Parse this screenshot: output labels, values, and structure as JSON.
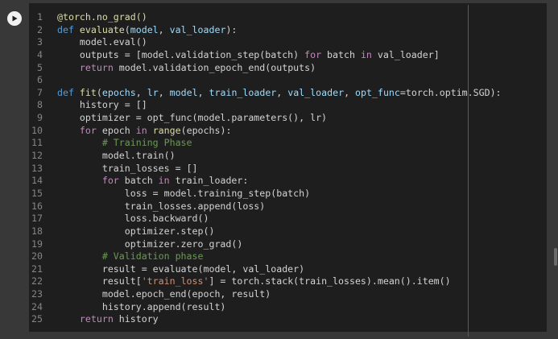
{
  "run_button": {
    "icon": "play-icon"
  },
  "code": {
    "lines": [
      {
        "n": "1",
        "tokens": [
          {
            "t": "@torch.no_grad()",
            "c": "fn"
          }
        ]
      },
      {
        "n": "2",
        "tokens": [
          {
            "t": "def ",
            "c": "kw"
          },
          {
            "t": "evaluate",
            "c": "fn"
          },
          {
            "t": "(",
            "c": "plain"
          },
          {
            "t": "model",
            "c": "param"
          },
          {
            "t": ", ",
            "c": "plain"
          },
          {
            "t": "val_loader",
            "c": "param"
          },
          {
            "t": "):",
            "c": "plain"
          }
        ]
      },
      {
        "n": "3",
        "tokens": [
          {
            "t": "    model.eval()",
            "c": "plain"
          }
        ]
      },
      {
        "n": "4",
        "tokens": [
          {
            "t": "    outputs = [model.validation_step(batch) ",
            "c": "plain"
          },
          {
            "t": "for",
            "c": "kw2"
          },
          {
            "t": " batch ",
            "c": "plain"
          },
          {
            "t": "in",
            "c": "kw2"
          },
          {
            "t": " val_loader]",
            "c": "plain"
          }
        ]
      },
      {
        "n": "5",
        "tokens": [
          {
            "t": "    ",
            "c": "plain"
          },
          {
            "t": "return",
            "c": "kw2"
          },
          {
            "t": " model.validation_epoch_end(outputs)",
            "c": "plain"
          }
        ]
      },
      {
        "n": "6",
        "tokens": []
      },
      {
        "n": "7",
        "tokens": [
          {
            "t": "def ",
            "c": "kw"
          },
          {
            "t": "fit",
            "c": "fn"
          },
          {
            "t": "(",
            "c": "plain"
          },
          {
            "t": "epochs",
            "c": "param"
          },
          {
            "t": ", ",
            "c": "plain"
          },
          {
            "t": "lr",
            "c": "param"
          },
          {
            "t": ", ",
            "c": "plain"
          },
          {
            "t": "model",
            "c": "param"
          },
          {
            "t": ", ",
            "c": "plain"
          },
          {
            "t": "train_loader",
            "c": "param"
          },
          {
            "t": ", ",
            "c": "plain"
          },
          {
            "t": "val_loader",
            "c": "param"
          },
          {
            "t": ", ",
            "c": "plain"
          },
          {
            "t": "opt_func",
            "c": "param"
          },
          {
            "t": "=torch.optim.SGD):",
            "c": "plain"
          }
        ]
      },
      {
        "n": "8",
        "tokens": [
          {
            "t": "    history = []",
            "c": "plain"
          }
        ]
      },
      {
        "n": "9",
        "tokens": [
          {
            "t": "    optimizer = opt_func(model.parameters(), lr)",
            "c": "plain"
          }
        ]
      },
      {
        "n": "10",
        "tokens": [
          {
            "t": "    ",
            "c": "plain"
          },
          {
            "t": "for",
            "c": "kw2"
          },
          {
            "t": " epoch ",
            "c": "plain"
          },
          {
            "t": "in",
            "c": "kw2"
          },
          {
            "t": " ",
            "c": "plain"
          },
          {
            "t": "range",
            "c": "fn"
          },
          {
            "t": "(epochs):",
            "c": "plain"
          }
        ]
      },
      {
        "n": "11",
        "tokens": [
          {
            "t": "        # Training Phase",
            "c": "cm"
          }
        ]
      },
      {
        "n": "12",
        "tokens": [
          {
            "t": "        model.train()",
            "c": "plain"
          }
        ]
      },
      {
        "n": "13",
        "tokens": [
          {
            "t": "        train_losses = []",
            "c": "plain"
          }
        ]
      },
      {
        "n": "14",
        "tokens": [
          {
            "t": "        ",
            "c": "plain"
          },
          {
            "t": "for",
            "c": "kw2"
          },
          {
            "t": " batch ",
            "c": "plain"
          },
          {
            "t": "in",
            "c": "kw2"
          },
          {
            "t": " train_loader:",
            "c": "plain"
          }
        ]
      },
      {
        "n": "15",
        "tokens": [
          {
            "t": "            loss = model.training_step(batch)",
            "c": "plain"
          }
        ]
      },
      {
        "n": "16",
        "tokens": [
          {
            "t": "            train_losses.append(loss)",
            "c": "plain"
          }
        ]
      },
      {
        "n": "17",
        "tokens": [
          {
            "t": "            loss.backward()",
            "c": "plain"
          }
        ]
      },
      {
        "n": "18",
        "tokens": [
          {
            "t": "            optimizer.step()",
            "c": "plain"
          }
        ]
      },
      {
        "n": "19",
        "tokens": [
          {
            "t": "            optimizer.zero_grad()",
            "c": "plain"
          }
        ]
      },
      {
        "n": "20",
        "tokens": [
          {
            "t": "        # Validation phase",
            "c": "cm"
          }
        ]
      },
      {
        "n": "21",
        "tokens": [
          {
            "t": "        result = evaluate(model, val_loader)",
            "c": "plain"
          }
        ]
      },
      {
        "n": "22",
        "tokens": [
          {
            "t": "        result[",
            "c": "plain"
          },
          {
            "t": "'train_loss'",
            "c": "str"
          },
          {
            "t": "] = torch.stack(train_losses).mean().item()",
            "c": "plain"
          }
        ]
      },
      {
        "n": "23",
        "tokens": [
          {
            "t": "        model.epoch_end(epoch, result)",
            "c": "plain"
          }
        ]
      },
      {
        "n": "24",
        "tokens": [
          {
            "t": "        history.append(result)",
            "c": "plain"
          }
        ]
      },
      {
        "n": "25",
        "tokens": [
          {
            "t": "    ",
            "c": "plain"
          },
          {
            "t": "return",
            "c": "kw2"
          },
          {
            "t": " history",
            "c": "plain"
          }
        ]
      }
    ]
  }
}
